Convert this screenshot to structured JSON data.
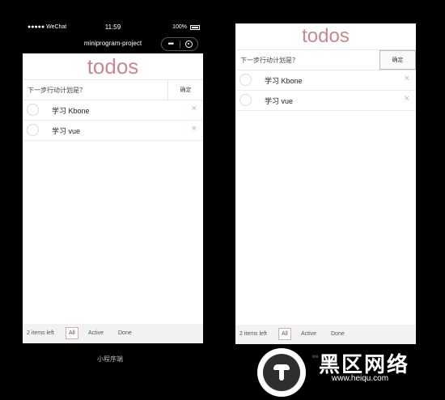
{
  "left_phone": {
    "status_bar": {
      "signal": "●●●●● WeChat",
      "time": "11:59",
      "battery": "100%"
    },
    "nav_bar": {
      "title": "miniprogram-project",
      "capsule_dots": "•••"
    },
    "title": "todos",
    "new_todo": {
      "placeholder": "下一步行动计划是？",
      "confirm_label": "确定"
    },
    "items": [
      {
        "text": "学习 Kbone",
        "delete_icon": "×"
      },
      {
        "text": "学习 vue",
        "delete_icon": "×"
      }
    ],
    "footer": {
      "count": "2 items left",
      "filters": [
        "All",
        "Active",
        "Done"
      ]
    }
  },
  "right_phone": {
    "title": "todos",
    "new_todo": {
      "placeholder": "下一步行动计划是？",
      "confirm_label": "确定"
    },
    "items": [
      {
        "text": "学习 Kbone",
        "delete_icon": "×"
      },
      {
        "text": "学习 vue",
        "delete_icon": "×"
      }
    ],
    "footer": {
      "count": "2 items left",
      "filters": [
        "All",
        "Active",
        "Done"
      ]
    }
  },
  "caption": "小程序端",
  "watermark": {
    "small": "we",
    "big": "黑区网络",
    "url": "www.heiqu.com"
  },
  "colors": {
    "accent": "#c9888c",
    "delete": "#e7a2a2",
    "background": "#000000"
  }
}
